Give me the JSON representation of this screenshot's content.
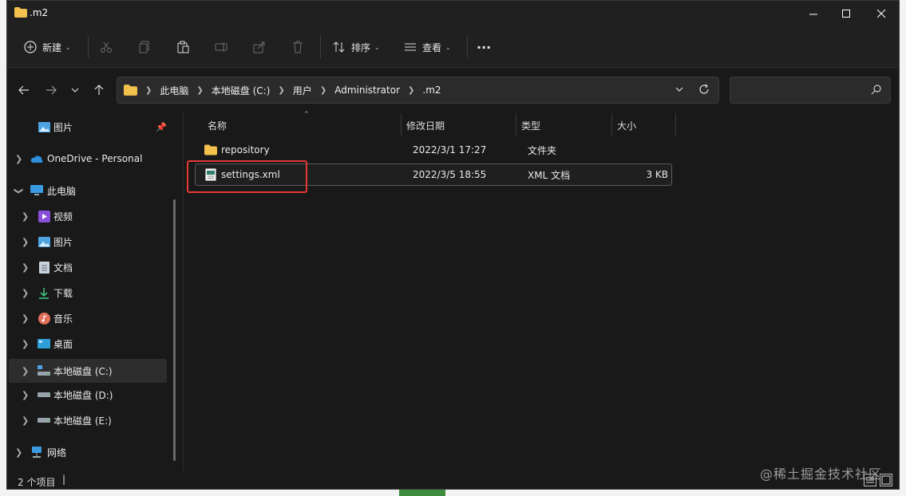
{
  "window": {
    "title": ".m2"
  },
  "toolbar": {
    "new_label": "新建",
    "sort_label": "排序",
    "view_label": "查看",
    "more_label": "···"
  },
  "address": {
    "crumbs": [
      "此电脑",
      "本地磁盘 (C:)",
      "用户",
      "Administrator",
      ".m2"
    ]
  },
  "search": {
    "placeholder": ""
  },
  "nav": {
    "pictures_quick": "图片",
    "onedrive": "OneDrive - Personal",
    "this_pc": "此电脑",
    "videos": "视频",
    "pictures": "图片",
    "documents": "文档",
    "downloads": "下载",
    "music": "音乐",
    "desktop": "桌面",
    "drive_c": "本地磁盘 (C:)",
    "drive_d": "本地磁盘 (D:)",
    "drive_e": "本地磁盘 (E:)",
    "network": "网络"
  },
  "columns": {
    "name": "名称",
    "modified": "修改日期",
    "type": "类型",
    "size": "大小"
  },
  "files": [
    {
      "name": "repository",
      "modified": "2022/3/1 17:27",
      "type": "文件夹",
      "size": ""
    },
    {
      "name": "settings.xml",
      "modified": "2022/3/5 18:55",
      "type": "XML 文档",
      "size": "3 KB"
    }
  ],
  "status": {
    "count": "2 个项目",
    "caret": "|"
  },
  "watermark": "@稀土掘金技术社区",
  "colors": {
    "accent_red": "#e53935",
    "folder": "#f2c14e",
    "background": "#1c1c1c"
  }
}
